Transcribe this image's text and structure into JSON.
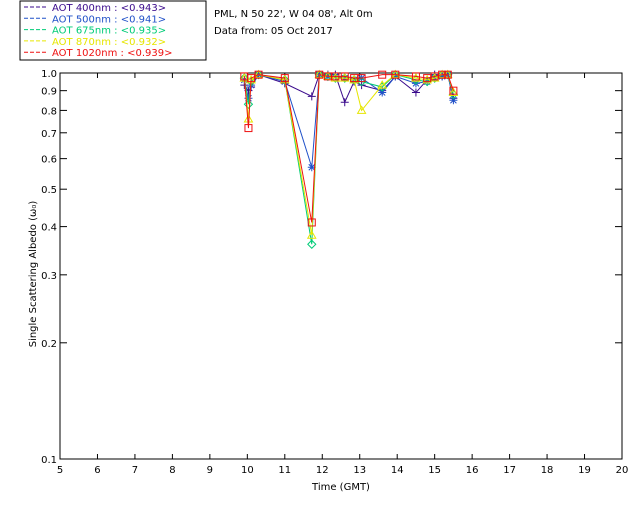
{
  "chart_data": {
    "type": "scatter",
    "title_lines": [
      "PML, N 50 22', W 04 08', Alt 0m",
      "Data from: 05 Oct 2017"
    ],
    "xlabel": "Time (GMT)",
    "ylabel": "Single Scattering Albedo (ω₀)",
    "xlim": [
      5,
      20
    ],
    "ylim": [
      0.1,
      1.0
    ],
    "yscale": "log",
    "x_ticks": [
      5,
      6,
      7,
      8,
      9,
      10,
      11,
      12,
      13,
      14,
      15,
      16,
      17,
      18,
      19,
      20
    ],
    "y_ticks": [
      0.1,
      0.2,
      0.3,
      0.4,
      0.5,
      0.6,
      0.7,
      0.8,
      0.9,
      1.0
    ],
    "grid": false,
    "legend_position": "top-left, outside",
    "series": [
      {
        "name": "AOT  400nm : <0.943>",
        "color": "#3a0a8c",
        "marker": "plus",
        "x": [
          9.92,
          10.03,
          10.1,
          10.3,
          11.0,
          11.72,
          11.92,
          12.15,
          12.35,
          12.6,
          12.85,
          13.05,
          13.6,
          13.95,
          14.5,
          14.8,
          15.0,
          15.2,
          15.35,
          15.5
        ],
        "y": [
          0.93,
          0.9,
          0.92,
          0.99,
          0.94,
          0.87,
          0.99,
          0.99,
          0.99,
          0.84,
          0.95,
          0.93,
          0.9,
          0.98,
          0.89,
          0.96,
          0.99,
          0.98,
          0.99,
          0.86
        ]
      },
      {
        "name": "AOT  500nm : <0.941>",
        "color": "#1f50c8",
        "marker": "star",
        "x": [
          9.92,
          10.03,
          10.1,
          10.3,
          11.0,
          11.72,
          11.92,
          12.15,
          12.35,
          12.6,
          12.85,
          13.05,
          13.6,
          13.95,
          14.5,
          14.8,
          15.0,
          15.2,
          15.35,
          15.5
        ],
        "y": [
          0.96,
          0.86,
          0.93,
          0.99,
          0.95,
          0.57,
          0.99,
          0.98,
          0.98,
          0.97,
          0.96,
          0.97,
          0.89,
          0.98,
          0.94,
          0.95,
          0.97,
          0.98,
          0.99,
          0.85
        ]
      },
      {
        "name": "AOT  675nm : <0.935>",
        "color": "#00cc77",
        "marker": "diamond",
        "x": [
          9.92,
          10.03,
          10.1,
          10.3,
          11.0,
          11.72,
          11.92,
          12.15,
          12.35,
          12.6,
          12.85,
          13.05,
          13.6,
          13.95,
          14.5,
          14.8,
          15.0,
          15.2,
          15.35,
          15.5
        ],
        "y": [
          0.97,
          0.83,
          0.95,
          0.99,
          0.96,
          0.36,
          0.99,
          0.98,
          0.97,
          0.97,
          0.96,
          0.95,
          0.92,
          0.99,
          0.96,
          0.95,
          0.97,
          0.99,
          0.99,
          0.88
        ]
      },
      {
        "name": "AOT  870nm : <0.932>",
        "color": "#e6e600",
        "marker": "triangle",
        "x": [
          9.92,
          10.03,
          10.1,
          10.3,
          11.0,
          11.72,
          11.92,
          12.15,
          12.35,
          12.6,
          12.85,
          13.05,
          13.6,
          13.95,
          14.5,
          14.8,
          15.0,
          15.2,
          15.35,
          15.5
        ],
        "y": [
          0.97,
          0.76,
          0.96,
          0.99,
          0.96,
          0.38,
          0.99,
          0.98,
          0.97,
          0.97,
          0.96,
          0.8,
          0.93,
          0.99,
          0.97,
          0.96,
          0.97,
          0.99,
          0.99,
          0.89
        ]
      },
      {
        "name": "AOT 1020nm : <0.939>",
        "color": "#ee1111",
        "marker": "square",
        "x": [
          9.92,
          10.03,
          10.1,
          10.3,
          11.0,
          11.72,
          11.92,
          12.15,
          12.35,
          12.6,
          12.85,
          13.05,
          13.6,
          13.95,
          14.5,
          14.8,
          15.0,
          15.2,
          15.35,
          15.5
        ],
        "y": [
          0.98,
          0.72,
          0.97,
          0.99,
          0.97,
          0.41,
          0.99,
          0.98,
          0.98,
          0.98,
          0.97,
          0.97,
          0.99,
          0.99,
          0.98,
          0.97,
          0.98,
          0.99,
          0.99,
          0.9
        ]
      }
    ]
  }
}
